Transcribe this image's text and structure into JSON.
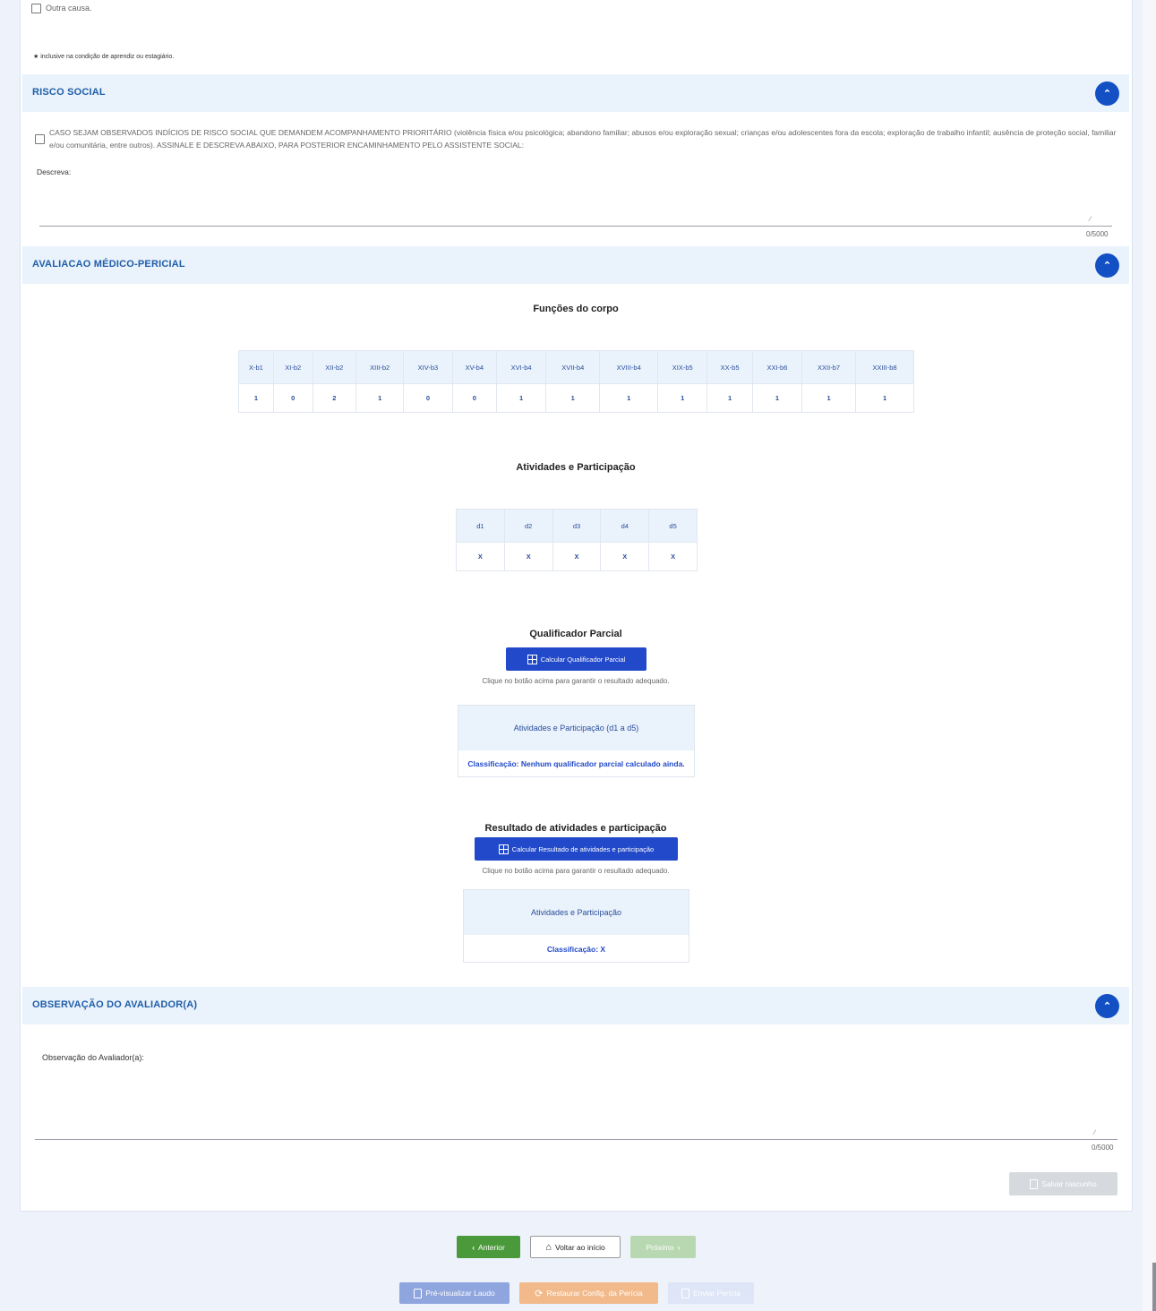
{
  "top": {
    "outra_causa": "Outra causa.",
    "footnote": "★ inclusive na condição de aprendiz ou estagiário."
  },
  "risco_social": {
    "title": "RISCO SOCIAL",
    "collapse_icon": "chevron-up-icon",
    "checkbox_text": "CASO SEJAM OBSERVADOS INDÍCIOS DE RISCO SOCIAL QUE DEMANDEM ACOMPANHAMENTO PRIORITÁRIO (violência física e/ou psicológica; abandono familiar; abusos e/ou exploração sexual; crianças e/ou adolescentes fora da escola; exploração de trabalho infantil; ausência de proteção social, familiar e/ou comunitária, entre outros). ASSINALE E DESCREVA ABAIXO, PARA POSTERIOR ENCAMINHAMENTO PELO ASSISTENTE SOCIAL:",
    "descreva_label": "Descreva:",
    "counter": "0/5000"
  },
  "avaliacao": {
    "title": "AVALIACAO MÉDICO-PERICIAL",
    "funcoes_title": "Funções do corpo",
    "funcoes_headers": [
      "X-b1",
      "XI-b2",
      "XII-b2",
      "XIII-b2",
      "XIV-b3",
      "XV-b4",
      "XVI-b4",
      "XVII-b4",
      "XVIII-b4",
      "XIX-b5",
      "XX-b5",
      "XXI-b6",
      "XXII-b7",
      "XXIII-b8"
    ],
    "funcoes_values": [
      "1",
      "0",
      "2",
      "1",
      "0",
      "0",
      "1",
      "1",
      "1",
      "1",
      "1",
      "1",
      "1",
      "1"
    ],
    "atividades_title": "Atividades e Participação",
    "atividades_headers": [
      "d1",
      "d2",
      "d3",
      "d4",
      "d5"
    ],
    "atividades_values": [
      "X",
      "X",
      "X",
      "X",
      "X"
    ],
    "qualificador_title": "Qualificador Parcial",
    "qualificador_button": "Calcular Qualificador Parcial",
    "qualificador_hint": "Clique no botão acima para garantir o resultado adequado.",
    "qualificador_box_head": "Atividades e Participação (d1 a d5)",
    "qualificador_box_body": "Classificação: Nenhum qualificador parcial calculado ainda.",
    "resultado_title": "Resultado de atividades e participação",
    "resultado_button": "Calcular Resultado de atividades e participação",
    "resultado_hint": "Clique no botão acima para garantir o resultado adequado.",
    "resultado_box_head": "Atividades e Participação",
    "resultado_box_body": "Classificação: X"
  },
  "observacao": {
    "title": "OBSERVAÇÃO DO AVALIADOR(A)",
    "label": "Observação do Avaliador(a):",
    "counter": "0/5000",
    "save_draft": "Salvar rascunho"
  },
  "nav": {
    "anterior": "Anterior",
    "voltar": "Voltar ao início",
    "proximo": "Próximo",
    "previsualizar": "Pré-visualizar Laudo",
    "restaurar": "Restaurar Config. da Perícia",
    "enviar": "Enviar Perícia"
  },
  "colors": {
    "accent": "#1350c4",
    "button_blue": "#2149c9",
    "section_bg": "#eaf2fc",
    "green": "#4a9a3c",
    "orange": "#f2b98a"
  }
}
